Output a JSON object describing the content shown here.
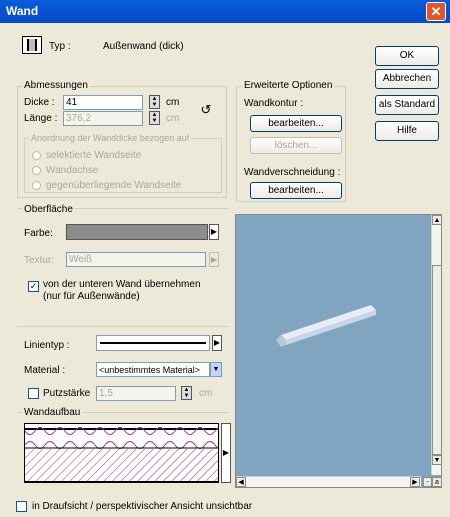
{
  "window": {
    "title": "Wand",
    "close_glyph": "✕"
  },
  "header": {
    "type_label": "Typ :",
    "type_value": "Außenwand (dick)"
  },
  "buttons": {
    "ok": "OK",
    "cancel": "Abbrechen",
    "as_default": "als Standard",
    "help": "Hilfe"
  },
  "dimensions": {
    "group_label": "Abmessungen",
    "thickness_label": "Dicke :",
    "thickness_value": "41",
    "length_label": "Länge :",
    "length_value": "376,2",
    "unit": "cm",
    "alignment_label": "Anordnung der Wanddicke bezogen auf",
    "radio_options": [
      "selektierte Wandseite",
      "Wandachse",
      "gegenüberliegende Wandseite"
    ]
  },
  "advanced": {
    "group_label": "Erweiterte Optionen",
    "contour_label": "Wandkontur :",
    "edit_label": "bearbeiten...",
    "delete_label": "löschen...",
    "intersection_label": "Wandverschneidung :"
  },
  "surface": {
    "group_label": "Oberfläche",
    "color_label": "Farbe:",
    "texture_label": "Textur:",
    "texture_value": "Weiß",
    "inherit_checkbox": "von der unteren Wand übernehmen\n(nur für Außenwände)"
  },
  "line": {
    "label": "Linientyp :"
  },
  "material": {
    "label": "Material :",
    "value": "<unbestimmtes Material>"
  },
  "plaster": {
    "label": "Putzstärke",
    "value": "1,5",
    "unit": "cm"
  },
  "build_up": {
    "group_label": "Wandaufbau"
  },
  "bottom_checkbox": "in Draufsicht / perspektivischer Ansicht unsichtbar",
  "colors": {
    "title_blue": "#0553D2",
    "preview_bg": "#7FA5C1",
    "hatch": "#A0307A"
  },
  "icons": {
    "wall_type": "wall-type-icon",
    "undo": "undo-icon",
    "arrow_right": "arrow-right-icon"
  }
}
